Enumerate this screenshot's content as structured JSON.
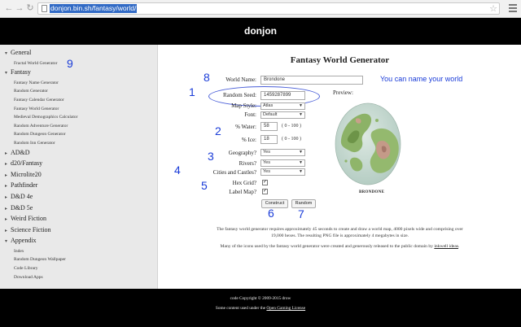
{
  "browser": {
    "url": "donjon.bin.sh/fantasy/world/",
    "back_icon": "←",
    "forward_icon": "→",
    "reload_icon": "↻",
    "star_icon": "☆"
  },
  "site": {
    "title": "donjon"
  },
  "sidebar": {
    "sections": [
      {
        "label": "General",
        "items": [
          "Fractal World Generator"
        ]
      },
      {
        "label": "Fantasy",
        "items": [
          "Fantasy Name Generator",
          "Random Generator",
          "Fantasy Calendar Generator",
          "Fantasy World Generator",
          "Medieval Demographics Calculator",
          "Random Adventure Generator",
          "Random Dungeon Generator",
          "Random Inn Generator"
        ]
      },
      {
        "label": "AD&D",
        "items": []
      },
      {
        "label": "d20/Fantasy",
        "items": []
      },
      {
        "label": "Microlite20",
        "items": []
      },
      {
        "label": "Pathfinder",
        "items": []
      },
      {
        "label": "D&D 4e",
        "items": []
      },
      {
        "label": "D&D 5e",
        "items": []
      },
      {
        "label": "Weird Fiction",
        "items": []
      },
      {
        "label": "Science Fiction",
        "items": []
      },
      {
        "label": "Appendix",
        "items": [
          "Index",
          "Random Dungeon Wallpaper",
          "Code Library",
          "Download Apps"
        ]
      }
    ]
  },
  "form": {
    "title": "Fantasy World Generator",
    "world_name_label": "World Name:",
    "world_name_value": "Brondone",
    "seed_label": "Random Seed:",
    "seed_value": "1459287899",
    "map_style_label": "Map Style:",
    "map_style_value": "Atlas",
    "font_label": "Font:",
    "font_value": "Default",
    "water_label": "% Water:",
    "water_value": "58",
    "water_range": "( 0 - 100 )",
    "ice_label": "% Ice:",
    "ice_value": "18",
    "ice_range": "( 0 - 100 )",
    "geography_label": "Geography?",
    "geography_value": "Yes",
    "rivers_label": "Rivers?",
    "rivers_value": "Yes",
    "cities_label": "Cities and Castles?",
    "cities_value": "Yes",
    "hexgrid_label": "Hex Grid?",
    "hexgrid_checked": "✓",
    "labelmap_label": "Label Map?",
    "labelmap_checked": "✓",
    "construct_label": "Construct",
    "random_label": "Random",
    "preview_label": "Preview:",
    "preview_name": "BRONDONE"
  },
  "annotations": {
    "n1": "1",
    "n2": "2",
    "n3": "3",
    "n4": "4",
    "n5": "5",
    "n6": "6",
    "n7": "7",
    "n8": "8",
    "n9": "9",
    "name_note": "You can name your world"
  },
  "info": {
    "para1_line1": "The fantasy world generator requires approximately 45 seconds to create and draw a world map, 4000 pixels wide and comprising over",
    "para1_line2": "19,000 hexes. The resulting PNG file is approximately 4 megabytes in size.",
    "para2_text": "Many of the icons used by the fantasy world generator were created and generously released to the public domain by ",
    "para2_link": "inkwell ideas",
    "para2_end": "."
  },
  "footer": {
    "copyright": "code Copyright © 2009-2015 drow",
    "license_text": "Some content used under the ",
    "license_link": "Open Gaming License"
  },
  "colors": {
    "annotation": "#1a3cd8",
    "url_selection": "#316ac5"
  }
}
